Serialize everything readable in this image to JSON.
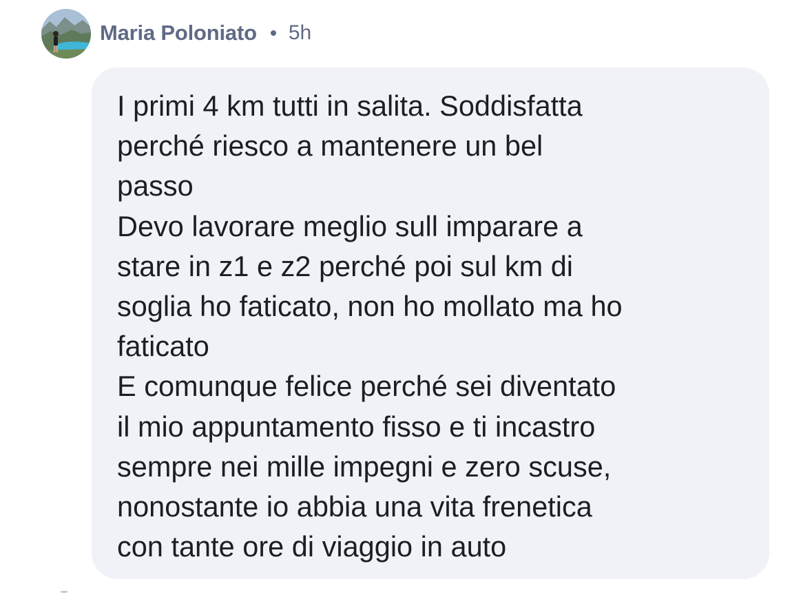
{
  "comment": {
    "author": "Maria Poloniato",
    "separator": "•",
    "timestamp": "5h",
    "avatar_icon": "profile-photo-avatar",
    "lines": [
      "I primi 4 km tutti in salita. Soddisfatta",
      "perché riesco a mantenere un bel",
      "passo",
      "Devo lavorare meglio sull imparare a",
      "stare in z1 e z2 perché poi sul km di",
      "soglia ho faticato, non ho mollato ma ho",
      "faticato",
      "E comunque felice perché sei diventato",
      "il mio appuntamento fisso e ti incastro",
      "sempre nei mille impegni e zero scuse,",
      "nonostante io abbia una vita frenetica",
      "con tante ore di viaggio in auto"
    ]
  },
  "colors": {
    "bubble_background": "#f0f2f7",
    "meta_text": "#606a85",
    "body_text": "#1c1e21"
  }
}
